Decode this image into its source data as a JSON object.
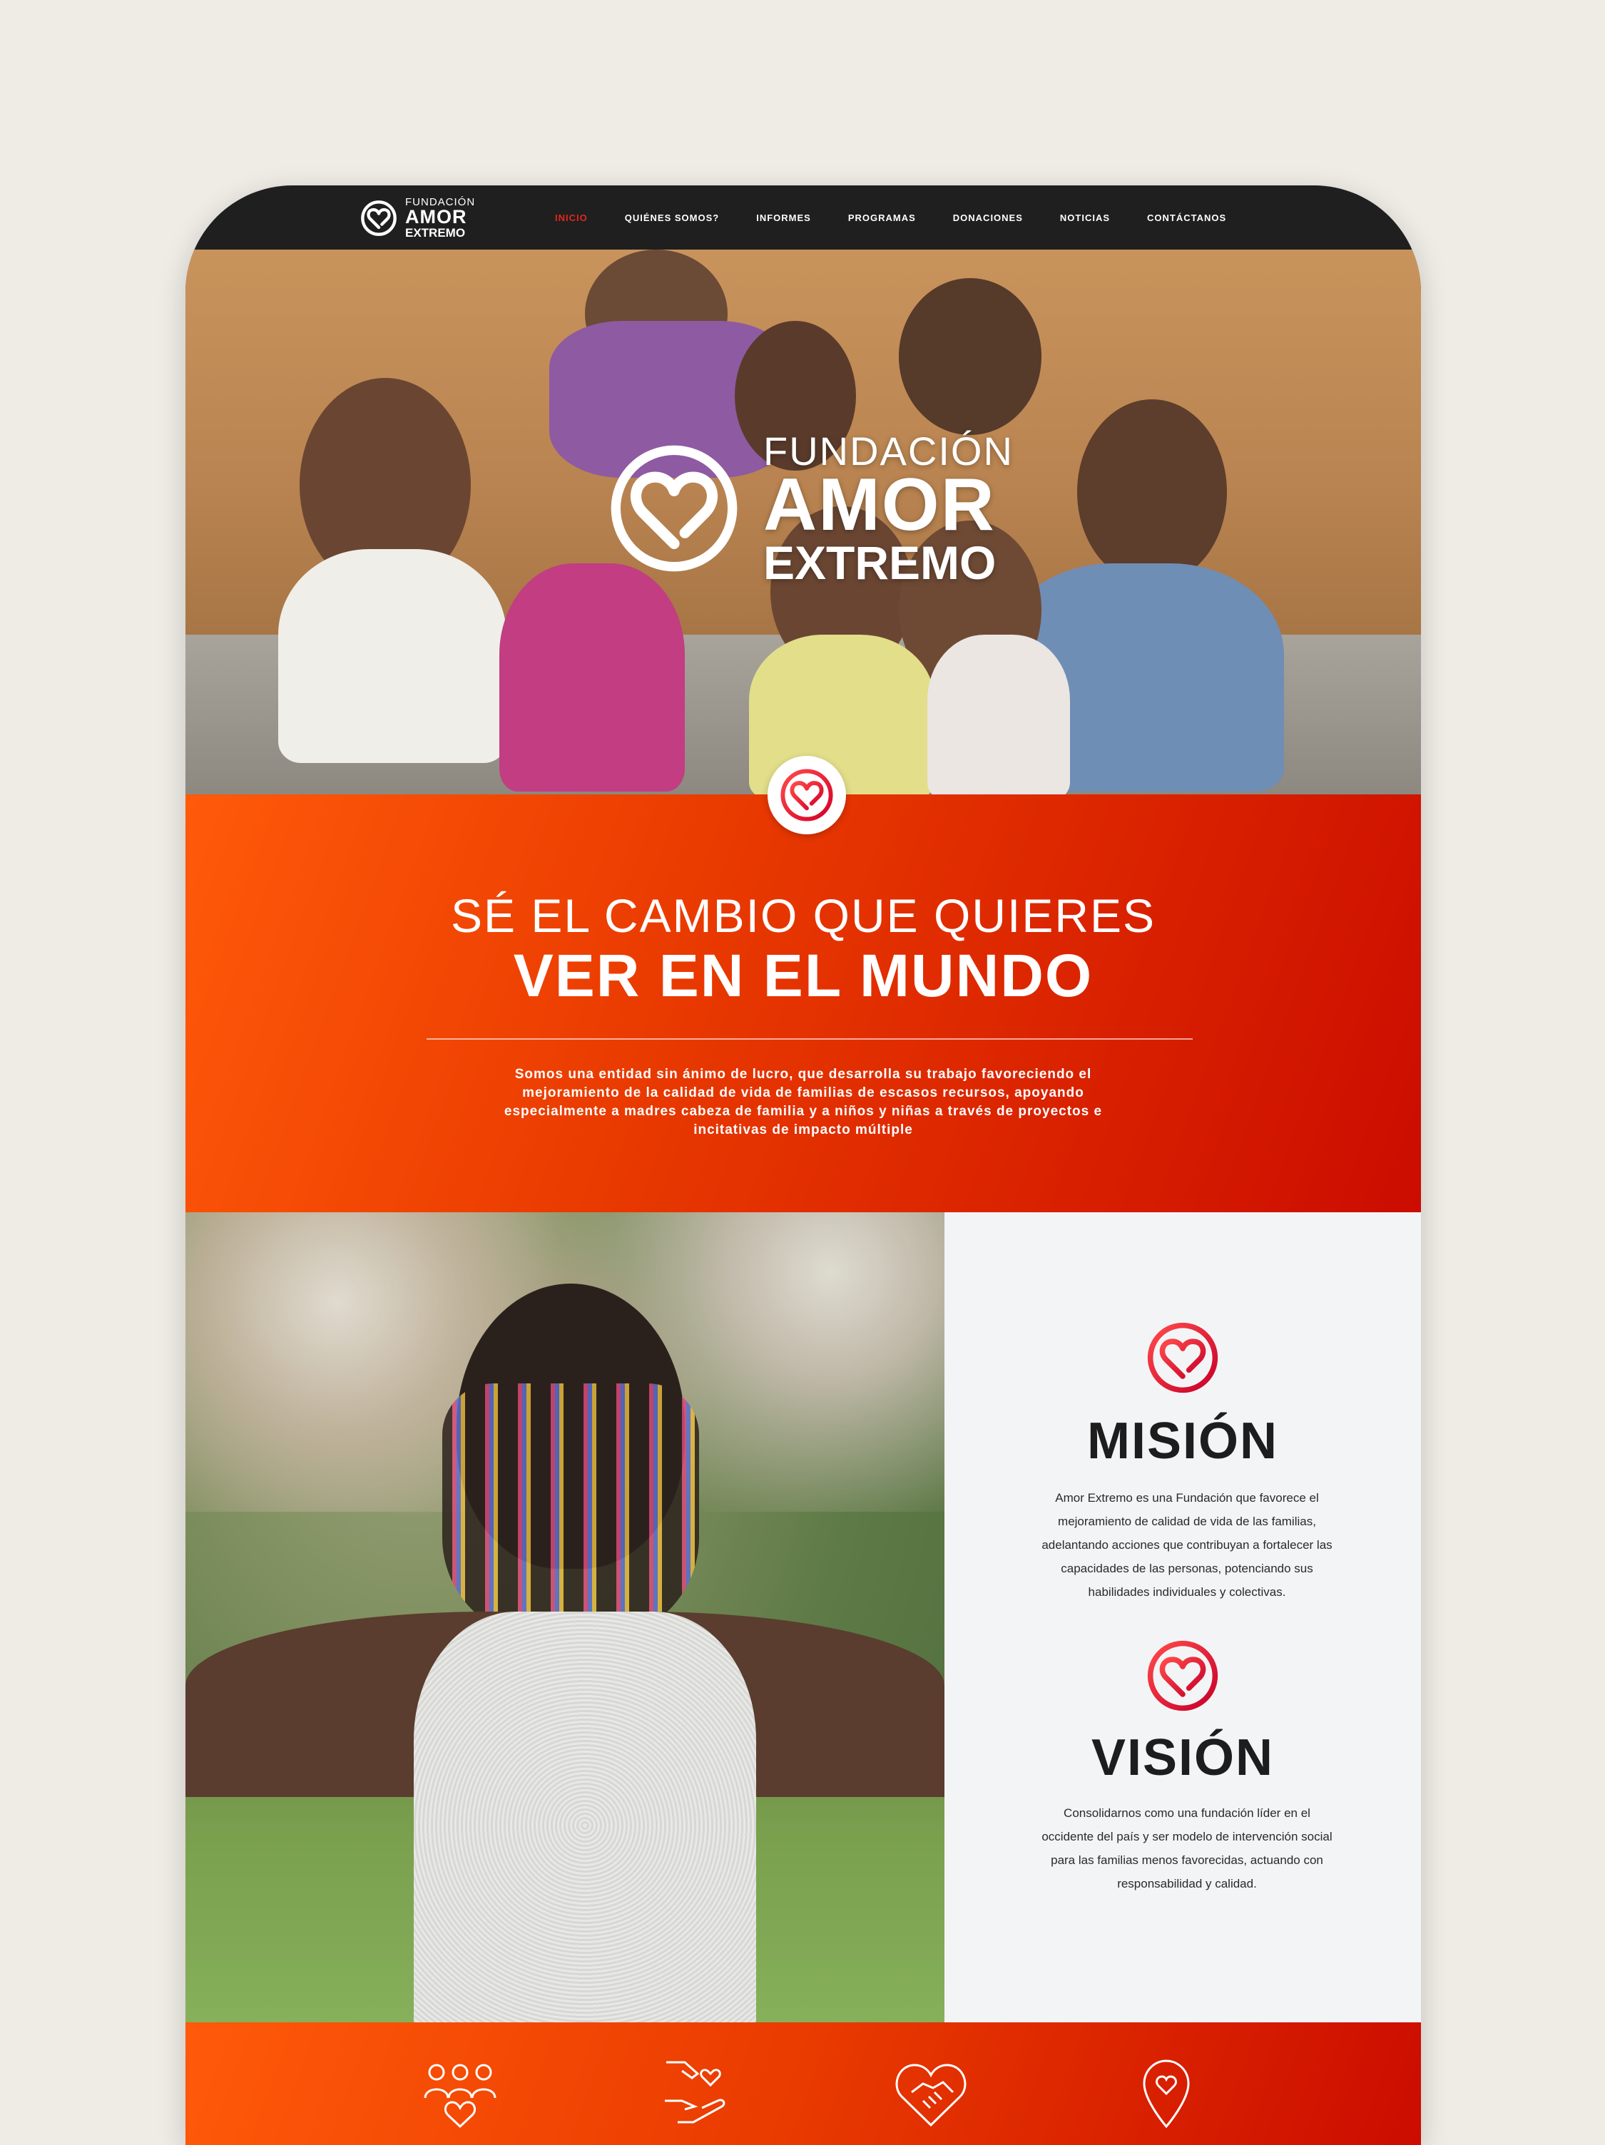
{
  "nav": {
    "logo": {
      "line1": "FUNDACIÓN",
      "line2": "AMOR",
      "line3": "EXTREMO"
    },
    "items": [
      {
        "label": "INICIO",
        "active": true
      },
      {
        "label": "QUIÉNES SOMOS?"
      },
      {
        "label": "INFORMES"
      },
      {
        "label": "PROGRAMAS"
      },
      {
        "label": "DONACIONES"
      },
      {
        "label": "NOTICIAS"
      },
      {
        "label": "CONTÁCTANOS"
      }
    ]
  },
  "hero": {
    "logo": {
      "line1": "FUNDACIÓN",
      "line2": "AMOR",
      "line3": "EXTREMO"
    },
    "badge_icon": "heart-ring-icon"
  },
  "slogan": {
    "line1": "SÉ EL CAMBIO QUE QUIERES",
    "line2": "VER EN EL MUNDO",
    "intro": "Somos una entidad sin ánimo de lucro, que desarrolla su trabajo favoreciendo el mejoramiento de la calidad de vida de familias de escasos recursos, apoyando especialmente a madres cabeza de familia y a niños y niñas a través de proyectos e incitativas de impacto múltiple"
  },
  "mision": {
    "title": "MISIÓN",
    "text": "Amor Extremo es una Fundación que favorece el mejoramiento de calidad de vida de las familias, adelantando acciones que contribuyan a fortalecer las capacidades de las personas, potenciando sus habilidades individuales y colectivas."
  },
  "vision": {
    "title": "VISIÓN",
    "text": "Consolidarnos como una fundación líder en el occidente del país y ser modelo de intervención social para las familias menos favorecidas, actuando con responsabilidad y calidad."
  },
  "features": {
    "icons": [
      "community-icon",
      "donation-hand-icon",
      "handshake-heart-icon",
      "location-heart-icon"
    ]
  },
  "colors": {
    "accent": "#e3261d",
    "orange_start": "#ff5a0a",
    "orange_end": "#cb0c00",
    "nav_bg": "#1f1f1f"
  }
}
